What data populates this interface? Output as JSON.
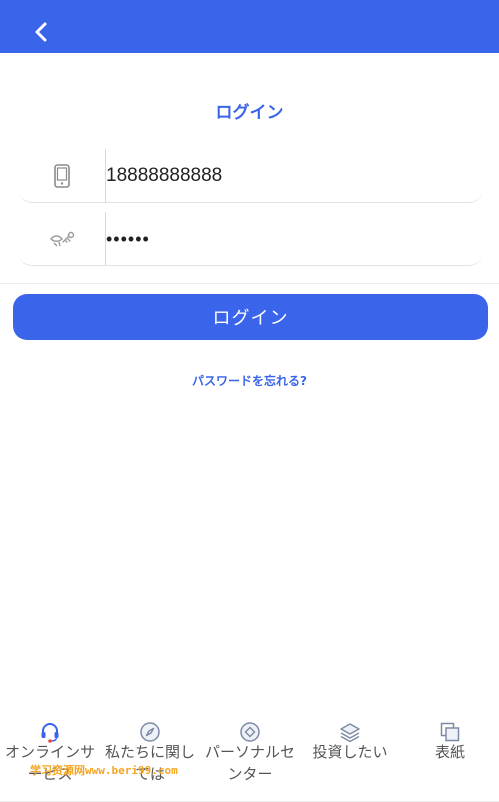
{
  "header": {
    "back_icon": "chevron-left-icon",
    "color": "#3a64ea"
  },
  "title": "ログイン",
  "form": {
    "phone": {
      "icon": "phone-icon",
      "value": "18888888888"
    },
    "password": {
      "icon": "lock-key-icon",
      "value": "••••••"
    },
    "login_label": "ログイン",
    "forgot_label": "パスワードを忘れる?"
  },
  "tabs": [
    {
      "icon": "headset-icon",
      "label": "オンラインサービス",
      "active": true
    },
    {
      "icon": "compass-icon",
      "label": "私たちに関しては"
    },
    {
      "icon": "diamond-icon",
      "label": "パーソナルセンター"
    },
    {
      "icon": "layers-icon",
      "label": "投資したい"
    },
    {
      "icon": "copy-icon",
      "label": "表紙"
    }
  ],
  "watermark": "学习资源网www.beri99.com",
  "colors": {
    "accent": "#3a64ea",
    "active_icon": "#3a64ea",
    "badge": "#f5a623"
  }
}
